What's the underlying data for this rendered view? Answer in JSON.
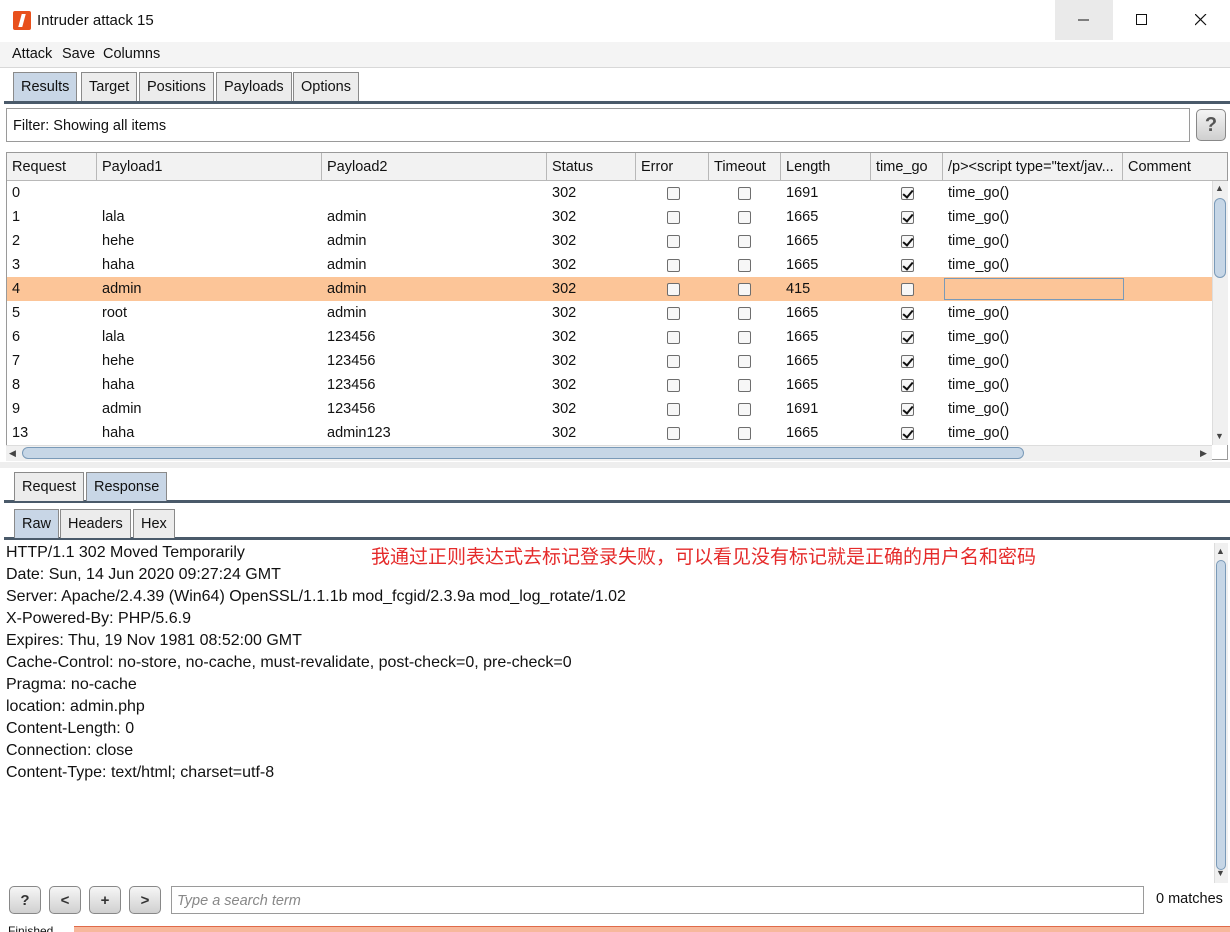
{
  "window": {
    "title": "Intruder attack 15",
    "minimize_icon": "minimize-icon",
    "maximize_icon": "maximize-icon",
    "close_icon": "close-icon"
  },
  "menu": [
    "Attack",
    "Save",
    "Columns"
  ],
  "top_tabs": [
    {
      "label": "Results",
      "active": true
    },
    {
      "label": "Target",
      "active": false
    },
    {
      "label": "Positions",
      "active": false
    },
    {
      "label": "Payloads",
      "active": false
    },
    {
      "label": "Options",
      "active": false
    }
  ],
  "filter": {
    "text": "Filter: Showing all items",
    "help_label": "?"
  },
  "table": {
    "columns": [
      "Request",
      "Payload1",
      "Payload2",
      "Status",
      "Error",
      "Timeout",
      "Length",
      "time_go",
      "/p><script type=\"text/jav...",
      "Comment"
    ],
    "rows": [
      {
        "request": "0",
        "payload1": "",
        "payload2": "",
        "status": "302",
        "error": false,
        "timeout": false,
        "length": "1691",
        "time_go": true,
        "extract": "time_go()",
        "comment": ""
      },
      {
        "request": "1",
        "payload1": "lala",
        "payload2": "admin",
        "status": "302",
        "error": false,
        "timeout": false,
        "length": "1665",
        "time_go": true,
        "extract": "time_go()",
        "comment": ""
      },
      {
        "request": "2",
        "payload1": "hehe",
        "payload2": "admin",
        "status": "302",
        "error": false,
        "timeout": false,
        "length": "1665",
        "time_go": true,
        "extract": "time_go()",
        "comment": ""
      },
      {
        "request": "3",
        "payload1": "haha",
        "payload2": "admin",
        "status": "302",
        "error": false,
        "timeout": false,
        "length": "1665",
        "time_go": true,
        "extract": "time_go()",
        "comment": ""
      },
      {
        "request": "4",
        "payload1": "admin",
        "payload2": "admin",
        "status": "302",
        "error": false,
        "timeout": false,
        "length": "415",
        "time_go": false,
        "extract": "",
        "comment": "",
        "selected": true
      },
      {
        "request": "5",
        "payload1": "root",
        "payload2": "admin",
        "status": "302",
        "error": false,
        "timeout": false,
        "length": "1665",
        "time_go": true,
        "extract": "time_go()",
        "comment": ""
      },
      {
        "request": "6",
        "payload1": "lala",
        "payload2": "123456",
        "status": "302",
        "error": false,
        "timeout": false,
        "length": "1665",
        "time_go": true,
        "extract": "time_go()",
        "comment": ""
      },
      {
        "request": "7",
        "payload1": "hehe",
        "payload2": "123456",
        "status": "302",
        "error": false,
        "timeout": false,
        "length": "1665",
        "time_go": true,
        "extract": "time_go()",
        "comment": ""
      },
      {
        "request": "8",
        "payload1": "haha",
        "payload2": "123456",
        "status": "302",
        "error": false,
        "timeout": false,
        "length": "1665",
        "time_go": true,
        "extract": "time_go()",
        "comment": ""
      },
      {
        "request": "9",
        "payload1": "admin",
        "payload2": "123456",
        "status": "302",
        "error": false,
        "timeout": false,
        "length": "1691",
        "time_go": true,
        "extract": "time_go()",
        "comment": ""
      },
      {
        "request": "13",
        "payload1": "haha",
        "payload2": "admin123",
        "status": "302",
        "error": false,
        "timeout": false,
        "length": "1665",
        "time_go": true,
        "extract": "time_go()",
        "comment": ""
      }
    ]
  },
  "detail_tabs": [
    {
      "label": "Request",
      "active": false
    },
    {
      "label": "Response",
      "active": true
    }
  ],
  "view_tabs": [
    {
      "label": "Raw",
      "active": true
    },
    {
      "label": "Headers",
      "active": false
    },
    {
      "label": "Hex",
      "active": false
    }
  ],
  "response_lines": [
    "HTTP/1.1 302 Moved Temporarily",
    "Date: Sun, 14 Jun 2020 09:27:24 GMT",
    "Server: Apache/2.4.39 (Win64) OpenSSL/1.1.1b mod_fcgid/2.3.9a mod_log_rotate/1.02",
    "X-Powered-By: PHP/5.6.9",
    "Expires: Thu, 19 Nov 1981 08:52:00 GMT",
    "Cache-Control: no-store, no-cache, must-revalidate, post-check=0, pre-check=0",
    "Pragma: no-cache",
    "location: admin.php",
    "Content-Length: 0",
    "Connection: close",
    "Content-Type: text/html; charset=utf-8"
  ],
  "annotation": "我通过正则表达式去标记登录失败，可以看见没有标记就是正确的用户名和密码",
  "search": {
    "placeholder": "Type a search term",
    "help_label": "?",
    "prev_label": "<",
    "add_label": "+",
    "next_label": ">",
    "matches": "0 matches"
  },
  "status": {
    "text": "Finished"
  },
  "colors": {
    "selected_row": "#fcc598",
    "active_tab": "#c8d6e6",
    "annotation": "#e52b2b",
    "progress": "#f7b89c"
  }
}
